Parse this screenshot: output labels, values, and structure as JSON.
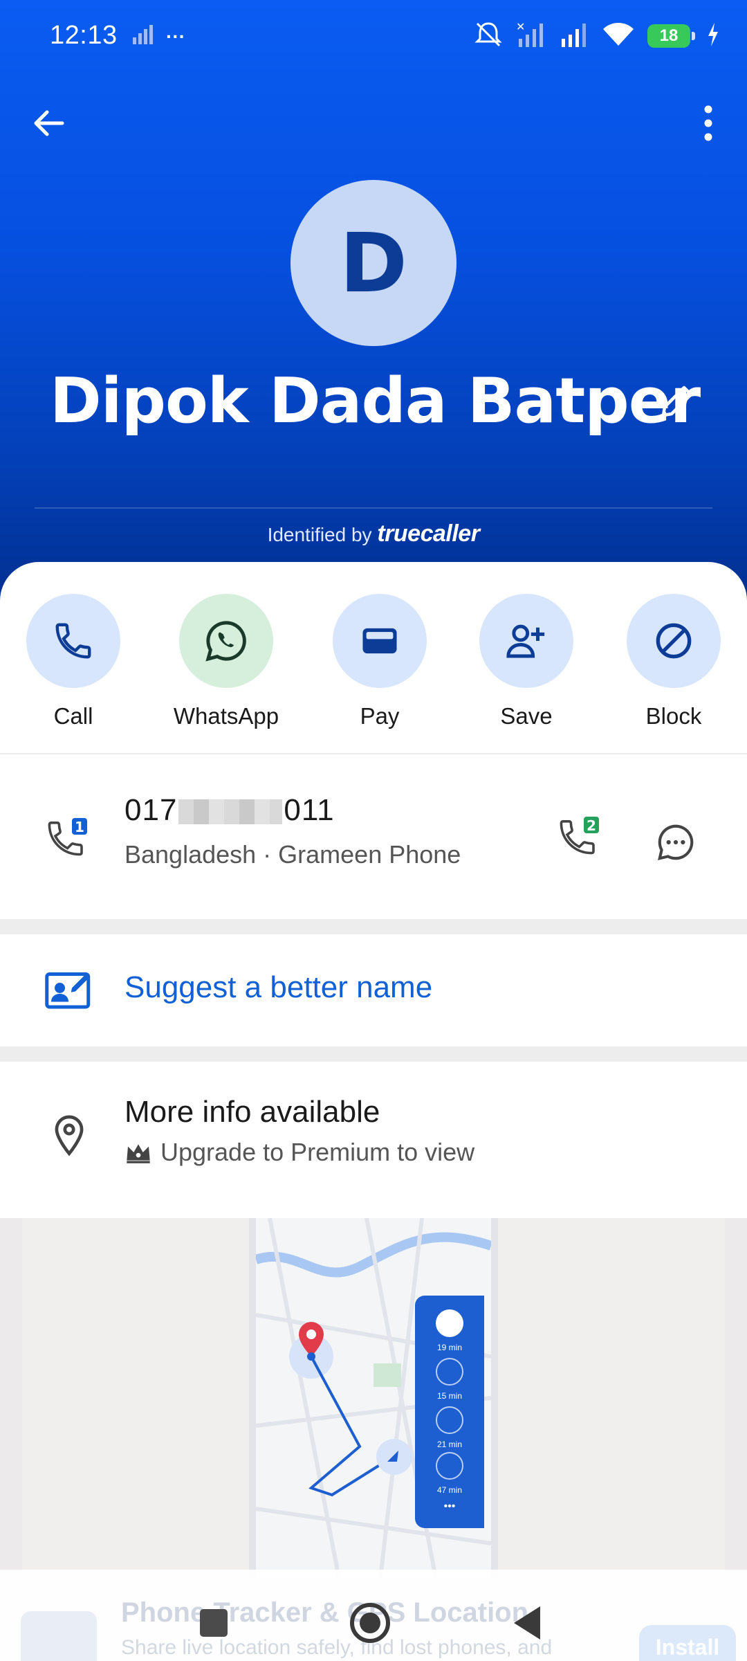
{
  "status_bar": {
    "time": "12:13",
    "more": "···",
    "battery": "18"
  },
  "header": {
    "avatar_letter": "D",
    "name": "Dipok Dada Batper",
    "identified_prefix": "Identified by",
    "identified_brand": "truecaller"
  },
  "actions": [
    {
      "label": "Call",
      "icon": "phone-icon"
    },
    {
      "label": "WhatsApp",
      "icon": "whatsapp-icon"
    },
    {
      "label": "Pay",
      "icon": "wallet-icon"
    },
    {
      "label": "Save",
      "icon": "add-person-icon"
    },
    {
      "label": "Block",
      "icon": "block-icon"
    }
  ],
  "phone": {
    "number_prefix": "017",
    "number_suffix": "011",
    "carrier": "Bangladesh · Grameen Phone",
    "sim1_badge": "1",
    "sim2_badge": "2"
  },
  "suggest": {
    "label": "Suggest a better name"
  },
  "more_info": {
    "title": "More info available",
    "subtitle": "Upgrade to Premium to view"
  },
  "ad": {
    "route_times": [
      "19 min",
      "15 min",
      "21 min",
      "47 min"
    ],
    "route_more": "•••",
    "title": "Phone Tracker & GPS Location",
    "description": "Share live location safely, find lost phones, and",
    "install_label": "Install"
  },
  "colors": {
    "header_top": "#0a5cf2",
    "header_bottom": "#022f8e",
    "action_circle": "#d7e6fd",
    "whatsapp_circle": "#d6efdd",
    "link": "#1260d6",
    "sim2_badge": "#22a25a"
  }
}
